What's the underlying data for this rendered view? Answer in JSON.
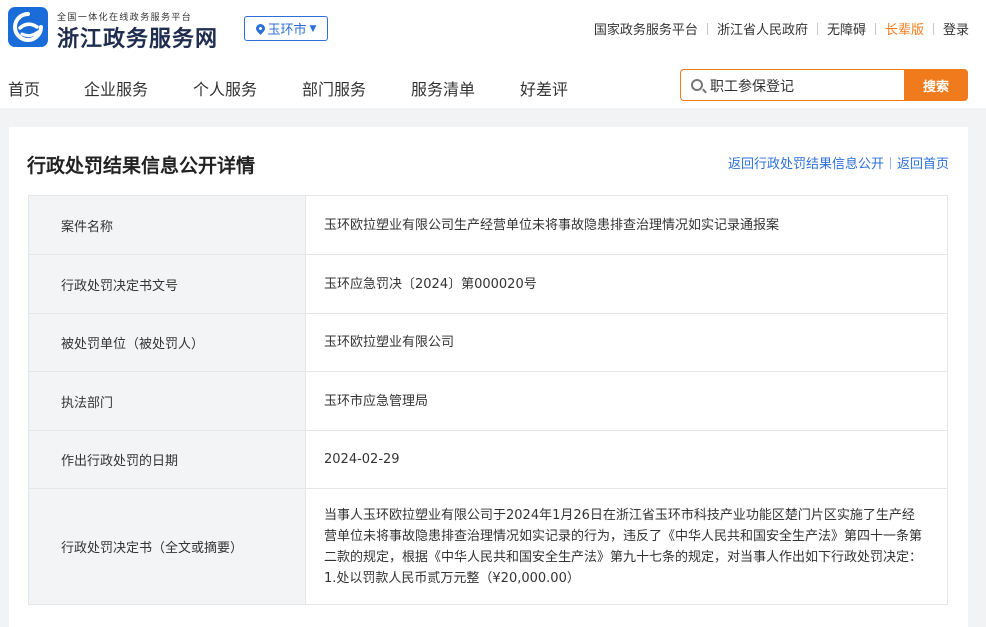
{
  "header": {
    "logo_subtitle": "全国一体化在线政务服务平台",
    "logo_title": "浙江政务服务网",
    "city": "玉环市",
    "links": [
      "国家政务服务平台",
      "浙江省人民政府",
      "无障碍",
      "长辈版",
      "登录"
    ]
  },
  "nav": {
    "items": [
      "首页",
      "企业服务",
      "个人服务",
      "部门服务",
      "服务清单",
      "好差评"
    ]
  },
  "search": {
    "value": "职工参保登记",
    "button_label": "搜索"
  },
  "page": {
    "title": "行政处罚结果信息公开详情",
    "back_link": "返回行政处罚结果信息公开",
    "home_link": "返回首页"
  },
  "details": [
    {
      "label": "案件名称",
      "value": "玉环欧拉塑业有限公司生产经营单位未将事故隐患排查治理情况如实记录通报案"
    },
    {
      "label": "行政处罚决定书文号",
      "value": "玉环应急罚决〔2024〕第000020号"
    },
    {
      "label": "被处罚单位（被处罚人）",
      "value": "玉环欧拉塑业有限公司"
    },
    {
      "label": "执法部门",
      "value": "玉环市应急管理局"
    },
    {
      "label": "作出行政处罚的日期",
      "value": "2024-02-29"
    },
    {
      "label": "行政处罚决定书（全文或摘要）",
      "value": "当事人玉环欧拉塑业有限公司于2024年1月26日在浙江省玉环市科技产业功能区楚门片区实施了生产经营单位未将事故隐患排查治理情况如实记录的行为，违反了《中华人民共和国安全生产法》第四十一条第二款的规定，根据《中华人民共和国安全生产法》第九十七条的规定，对当事人作出如下行政处罚决定：1.处以罚款人民币贰万元整（¥20,000.00）"
    }
  ],
  "colors": {
    "brand_blue": "#1a6dd8",
    "accent_orange": "#f07b1c",
    "link_blue": "#2d6fd8"
  }
}
